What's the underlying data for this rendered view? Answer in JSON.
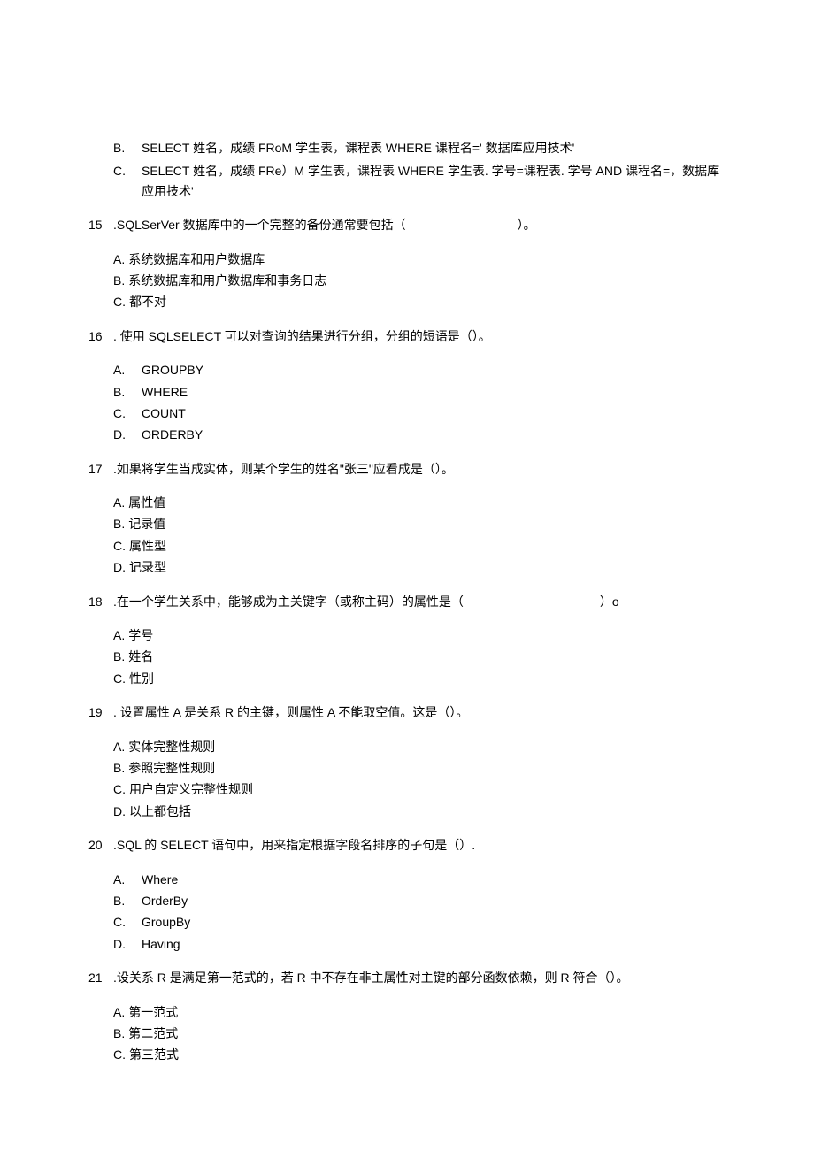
{
  "pre_options": [
    {
      "letter": "B.",
      "text": "SELECT 姓名，成绩 FRoM 学生表，课程表 WHERE 课程名=' 数据库应用技术'"
    },
    {
      "letter": "C.",
      "text": "SELECT 姓名，成绩 FRe）M 学生表，课程表 WHERE 学生表. 学号=课程表. 学号 AND 课程名=，数据库应用技术'"
    }
  ],
  "questions": [
    {
      "num": "15",
      "text": ".SQLSerVer 数据库中的一个完整的备份通常要包括（　　　　　　　　　）。",
      "options": [
        {
          "letter": "A.",
          "text": "系统数据库和用户数据库"
        },
        {
          "letter": "B.",
          "text": "系统数据库和用户数据库和事务日志"
        },
        {
          "letter": "C.",
          "text": "都不对"
        }
      ]
    },
    {
      "num": "16",
      "text": ". 使用 SQLSELECT 可以对查询的结果进行分组，分组的短语是（）。",
      "options": [
        {
          "letter": "A.",
          "text": "GROUPBY",
          "wide": true
        },
        {
          "letter": "B.",
          "text": "WHERE",
          "wide": true
        },
        {
          "letter": "C.",
          "text": "COUNT",
          "wide": true
        },
        {
          "letter": "D.",
          "text": "ORDERBY",
          "wide": true
        }
      ]
    },
    {
      "num": "17",
      "text": ".如果将学生当成实体，则某个学生的姓名\"张三\"应看成是（）。",
      "options": [
        {
          "letter": "A.",
          "text": "属性值"
        },
        {
          "letter": "B.",
          "text": "记录值"
        },
        {
          "letter": "C.",
          "text": "属性型"
        },
        {
          "letter": "D.",
          "text": "记录型"
        }
      ]
    },
    {
      "num": "18",
      "text": ".在一个学生关系中，能够成为主关键字（或称主码）的属性是（　　　　　　　　　　　）o",
      "options": [
        {
          "letter": "A.",
          "text": "学号"
        },
        {
          "letter": "B.",
          "text": "姓名"
        },
        {
          "letter": "C.",
          "text": "性别"
        }
      ]
    },
    {
      "num": "19",
      "text": ". 设置属性 A 是关系 R 的主键，则属性 A 不能取空值。这是（）。",
      "options": [
        {
          "letter": "A.",
          "text": "实体完整性规则"
        },
        {
          "letter": "B.",
          "text": "参照完整性规则"
        },
        {
          "letter": "C.",
          "text": "用户自定义完整性规则"
        },
        {
          "letter": "D.",
          "text": "以上都包括"
        }
      ]
    },
    {
      "num": "20",
      "text": ".SQL 的 SELECT 语句中，用来指定根据字段名排序的子句是（）.",
      "options": [
        {
          "letter": "A.",
          "text": "Where",
          "wide": true
        },
        {
          "letter": "B.",
          "text": "OrderBy",
          "wide": true
        },
        {
          "letter": "C.",
          "text": "GroupBy",
          "wide": true
        },
        {
          "letter": "D.",
          "text": "Having",
          "wide": true
        }
      ]
    },
    {
      "num": "21",
      "text": ".设关系 R 是满足第一范式的，若 R 中不存在非主属性对主键的部分函数依赖，则 R 符合（）。",
      "options": [
        {
          "letter": "A.",
          "text": "第一范式"
        },
        {
          "letter": "B.",
          "text": "第二范式"
        },
        {
          "letter": "C.",
          "text": "第三范式"
        }
      ]
    }
  ]
}
